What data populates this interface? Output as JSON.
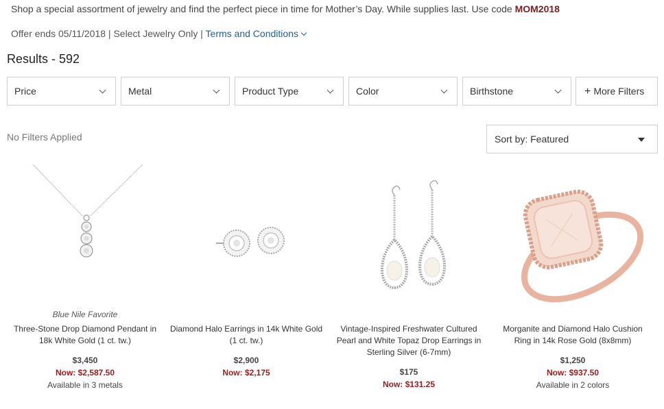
{
  "promo": {
    "text": "Shop a special assortment of jewelry and find the perfect piece in time for Mother’s Day. While supplies last. Use code ",
    "code": "MOM2018",
    "offer_text": "Offer ends 05/11/2018 | Select Jewelry Only | ",
    "terms_label": "Terms and Conditions"
  },
  "results_label": "Results - 592",
  "filters": [
    {
      "label": "Price"
    },
    {
      "label": "Metal"
    },
    {
      "label": "Product Type"
    },
    {
      "label": "Color"
    },
    {
      "label": "Birthstone"
    }
  ],
  "more_filters_label": "More Filters",
  "no_filters_label": "No Filters Applied",
  "sort_label": "Sort by: Featured",
  "products": [
    {
      "badge": "Blue Nile Favorite",
      "name": "Three-Stone Drop Diamond Pendant in 18k White Gold (1 ct. tw.)",
      "price": "$3,450",
      "sale": "Now: $2,587.50",
      "availability": "Available in 3 metals",
      "image": "diamond-pendant-image"
    },
    {
      "badge": "",
      "name": "Diamond Halo Earrings in 14k White Gold (1 ct. tw.)",
      "price": "$2,900",
      "sale": "Now: $2,175",
      "availability": "",
      "image": "diamond-earrings-image"
    },
    {
      "badge": "",
      "name": "Vintage-Inspired Freshwater Cultured Pearl and White Topaz Drop Earrings in Sterling Silver (6-7mm)",
      "price": "$175",
      "sale": "Now: $131.25",
      "availability": "",
      "image": "pearl-drop-earrings-image"
    },
    {
      "badge": "",
      "name": "Morganite and Diamond Halo Cushion Ring in 14k Rose Gold (8x8mm)",
      "price": "$1,250",
      "sale": "Now: $937.50",
      "availability": "Available in 2 colors",
      "image": "morganite-ring-image"
    }
  ],
  "colors": {
    "promo_code": "#7a1f1f",
    "sale_price": "#9b1c1c",
    "link": "#1f5fa6",
    "rose_gold": "#e8b4a0"
  }
}
